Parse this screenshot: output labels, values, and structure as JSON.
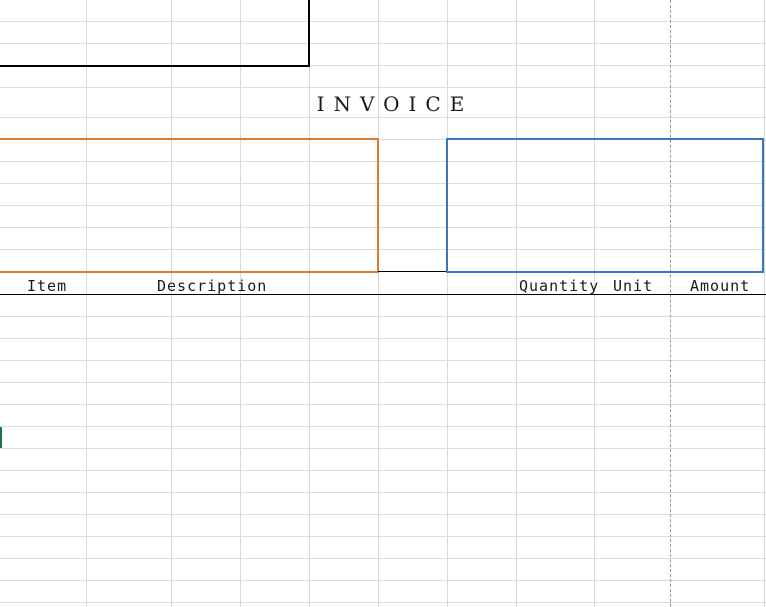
{
  "invoice": {
    "title": "INVOICE"
  },
  "table_header": {
    "item": "Item",
    "description": "Description",
    "quantity": "Quantity",
    "unit": "Unit",
    "amount": "Amount"
  },
  "colors": {
    "gridline": "#d9d9d9",
    "sender_border": "#000000",
    "bill_to_border": "#e07a2e",
    "invoice_info_border": "#3d72c4",
    "page_break": "#9a9a9a",
    "active_cell": "#217346"
  }
}
